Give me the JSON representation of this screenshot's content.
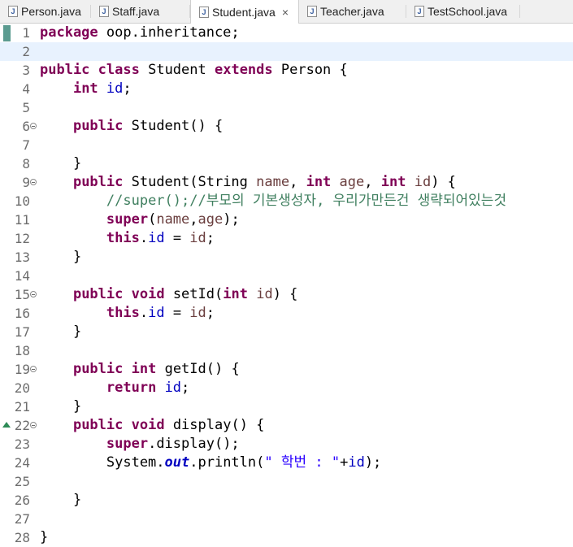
{
  "tabs": [
    {
      "label": "Person.java",
      "active": false
    },
    {
      "label": "Staff.java",
      "active": false
    },
    {
      "label": "Student.java",
      "active": true
    },
    {
      "label": "Teacher.java",
      "active": false
    },
    {
      "label": "TestSchool.java",
      "active": false
    }
  ],
  "tab_close_glyph": "×",
  "current_line": 2,
  "lines": [
    {
      "n": "1",
      "tokens": [
        {
          "t": "kw",
          "v": "package"
        },
        {
          "t": "plain",
          "v": " oop.inheritance;"
        }
      ]
    },
    {
      "n": "2",
      "tokens": []
    },
    {
      "n": "3",
      "tokens": [
        {
          "t": "kw",
          "v": "public"
        },
        {
          "t": "plain",
          "v": " "
        },
        {
          "t": "kw",
          "v": "class"
        },
        {
          "t": "plain",
          "v": " Student "
        },
        {
          "t": "kw",
          "v": "extends"
        },
        {
          "t": "plain",
          "v": " Person {"
        }
      ]
    },
    {
      "n": "4",
      "tokens": [
        {
          "t": "plain",
          "v": "    "
        },
        {
          "t": "kw",
          "v": "int"
        },
        {
          "t": "plain",
          "v": " "
        },
        {
          "t": "fld",
          "v": "id"
        },
        {
          "t": "plain",
          "v": ";"
        }
      ]
    },
    {
      "n": "5",
      "tokens": []
    },
    {
      "n": "6",
      "fold": true,
      "tokens": [
        {
          "t": "plain",
          "v": "    "
        },
        {
          "t": "kw",
          "v": "public"
        },
        {
          "t": "plain",
          "v": " Student() {"
        }
      ]
    },
    {
      "n": "7",
      "tokens": []
    },
    {
      "n": "8",
      "tokens": [
        {
          "t": "plain",
          "v": "    }"
        }
      ]
    },
    {
      "n": "9",
      "fold": true,
      "tokens": [
        {
          "t": "plain",
          "v": "    "
        },
        {
          "t": "kw",
          "v": "public"
        },
        {
          "t": "plain",
          "v": " Student(String "
        },
        {
          "t": "prm",
          "v": "name"
        },
        {
          "t": "plain",
          "v": ", "
        },
        {
          "t": "kw",
          "v": "int"
        },
        {
          "t": "plain",
          "v": " "
        },
        {
          "t": "prm",
          "v": "age"
        },
        {
          "t": "plain",
          "v": ", "
        },
        {
          "t": "kw",
          "v": "int"
        },
        {
          "t": "plain",
          "v": " "
        },
        {
          "t": "prm",
          "v": "id"
        },
        {
          "t": "plain",
          "v": ") {"
        }
      ]
    },
    {
      "n": "10",
      "tokens": [
        {
          "t": "plain",
          "v": "        "
        },
        {
          "t": "cmt",
          "v": "//super();//부모의 기본생성자, 우리가만든건 생략되어있는것"
        }
      ]
    },
    {
      "n": "11",
      "tokens": [
        {
          "t": "plain",
          "v": "        "
        },
        {
          "t": "kw",
          "v": "super"
        },
        {
          "t": "plain",
          "v": "("
        },
        {
          "t": "prm",
          "v": "name"
        },
        {
          "t": "plain",
          "v": ","
        },
        {
          "t": "prm",
          "v": "age"
        },
        {
          "t": "plain",
          "v": ");"
        }
      ]
    },
    {
      "n": "12",
      "tokens": [
        {
          "t": "plain",
          "v": "        "
        },
        {
          "t": "kw",
          "v": "this"
        },
        {
          "t": "plain",
          "v": "."
        },
        {
          "t": "fld",
          "v": "id"
        },
        {
          "t": "plain",
          "v": " = "
        },
        {
          "t": "prm",
          "v": "id"
        },
        {
          "t": "plain",
          "v": ";"
        }
      ]
    },
    {
      "n": "13",
      "tokens": [
        {
          "t": "plain",
          "v": "    }"
        }
      ]
    },
    {
      "n": "14",
      "tokens": []
    },
    {
      "n": "15",
      "fold": true,
      "tokens": [
        {
          "t": "plain",
          "v": "    "
        },
        {
          "t": "kw",
          "v": "public"
        },
        {
          "t": "plain",
          "v": " "
        },
        {
          "t": "kw",
          "v": "void"
        },
        {
          "t": "plain",
          "v": " setId("
        },
        {
          "t": "kw",
          "v": "int"
        },
        {
          "t": "plain",
          "v": " "
        },
        {
          "t": "prm",
          "v": "id"
        },
        {
          "t": "plain",
          "v": ") {"
        }
      ]
    },
    {
      "n": "16",
      "tokens": [
        {
          "t": "plain",
          "v": "        "
        },
        {
          "t": "kw",
          "v": "this"
        },
        {
          "t": "plain",
          "v": "."
        },
        {
          "t": "fld",
          "v": "id"
        },
        {
          "t": "plain",
          "v": " = "
        },
        {
          "t": "prm",
          "v": "id"
        },
        {
          "t": "plain",
          "v": ";"
        }
      ]
    },
    {
      "n": "17",
      "tokens": [
        {
          "t": "plain",
          "v": "    }"
        }
      ]
    },
    {
      "n": "18",
      "tokens": []
    },
    {
      "n": "19",
      "fold": true,
      "tokens": [
        {
          "t": "plain",
          "v": "    "
        },
        {
          "t": "kw",
          "v": "public"
        },
        {
          "t": "plain",
          "v": " "
        },
        {
          "t": "kw",
          "v": "int"
        },
        {
          "t": "plain",
          "v": " getId() {"
        }
      ]
    },
    {
      "n": "20",
      "tokens": [
        {
          "t": "plain",
          "v": "        "
        },
        {
          "t": "kw",
          "v": "return"
        },
        {
          "t": "plain",
          "v": " "
        },
        {
          "t": "fld",
          "v": "id"
        },
        {
          "t": "plain",
          "v": ";"
        }
      ]
    },
    {
      "n": "21",
      "tokens": [
        {
          "t": "plain",
          "v": "    }"
        }
      ]
    },
    {
      "n": "22",
      "fold": true,
      "override": true,
      "tokens": [
        {
          "t": "plain",
          "v": "    "
        },
        {
          "t": "kw",
          "v": "public"
        },
        {
          "t": "plain",
          "v": " "
        },
        {
          "t": "kw",
          "v": "void"
        },
        {
          "t": "plain",
          "v": " display() {"
        }
      ]
    },
    {
      "n": "23",
      "tokens": [
        {
          "t": "plain",
          "v": "        "
        },
        {
          "t": "kw",
          "v": "super"
        },
        {
          "t": "plain",
          "v": ".display();"
        }
      ]
    },
    {
      "n": "24",
      "tokens": [
        {
          "t": "plain",
          "v": "        System."
        },
        {
          "t": "sfld",
          "v": "out"
        },
        {
          "t": "plain",
          "v": ".println("
        },
        {
          "t": "str",
          "v": "\" 학번 : \""
        },
        {
          "t": "plain",
          "v": "+"
        },
        {
          "t": "fld",
          "v": "id"
        },
        {
          "t": "plain",
          "v": ");"
        }
      ]
    },
    {
      "n": "25",
      "tokens": []
    },
    {
      "n": "26",
      "tokens": [
        {
          "t": "plain",
          "v": "    }"
        }
      ]
    },
    {
      "n": "27",
      "tokens": []
    },
    {
      "n": "28",
      "tokens": [
        {
          "t": "plain",
          "v": "}"
        }
      ]
    }
  ]
}
